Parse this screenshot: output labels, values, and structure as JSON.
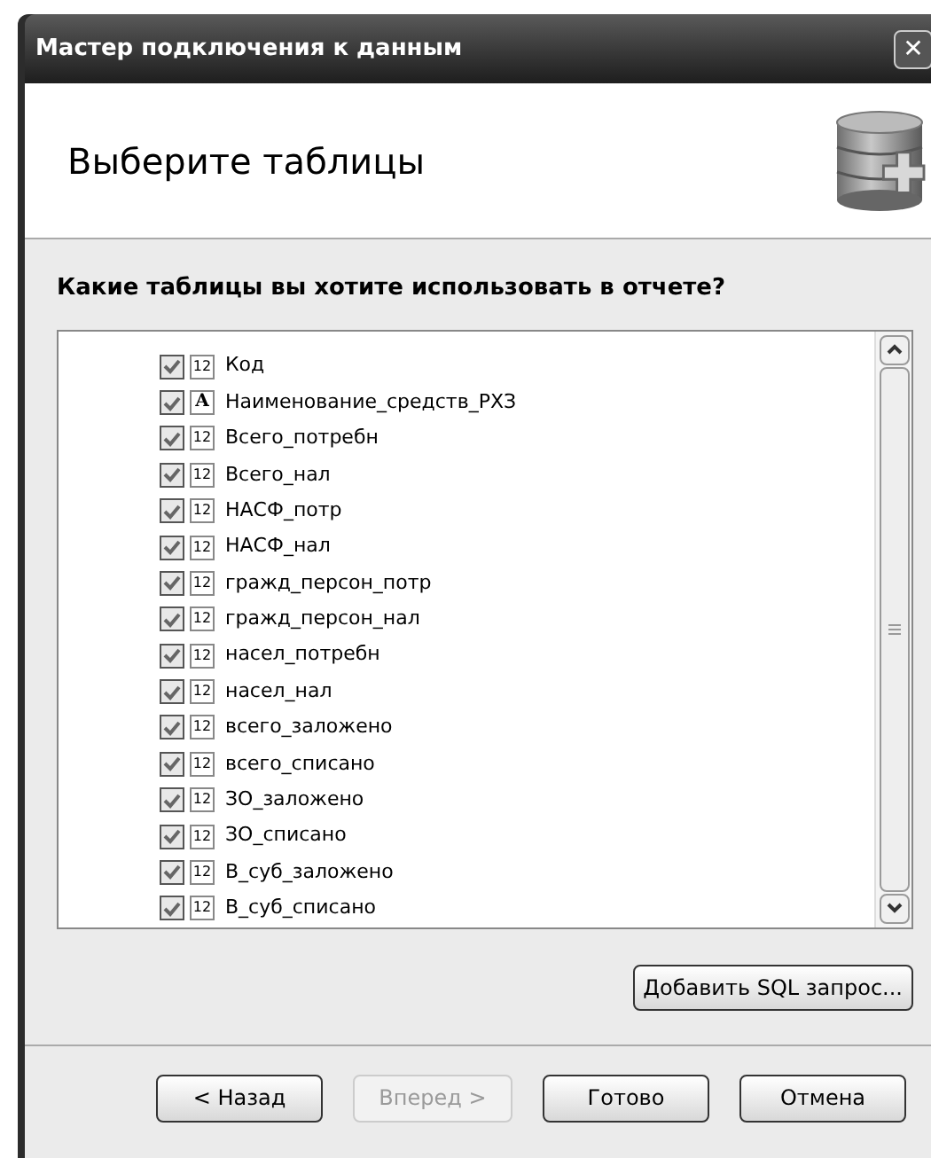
{
  "window": {
    "title": "Мастер подключения к данным",
    "close": "✕"
  },
  "header": {
    "title": "Выберите таблицы"
  },
  "question": "Какие таблицы вы хотите использовать в отчете?",
  "fields": [
    {
      "label": "Код",
      "checked": true,
      "type_glyph": "12",
      "kind": "number"
    },
    {
      "label": "Наименование_средств_РХЗ",
      "checked": true,
      "type_glyph": "A",
      "kind": "text"
    },
    {
      "label": "Всего_потребн",
      "checked": true,
      "type_glyph": "12",
      "kind": "number"
    },
    {
      "label": "Всего_нал",
      "checked": true,
      "type_glyph": "12",
      "kind": "number"
    },
    {
      "label": "НАСФ_потр",
      "checked": true,
      "type_glyph": "12",
      "kind": "number"
    },
    {
      "label": "НАСФ_нал",
      "checked": true,
      "type_glyph": "12",
      "kind": "number"
    },
    {
      "label": "гражд_персон_потр",
      "checked": true,
      "type_glyph": "12",
      "kind": "number"
    },
    {
      "label": "гражд_персон_нал",
      "checked": true,
      "type_glyph": "12",
      "kind": "number"
    },
    {
      "label": "насел_потребн",
      "checked": true,
      "type_glyph": "12",
      "kind": "number"
    },
    {
      "label": "насел_нал",
      "checked": true,
      "type_glyph": "12",
      "kind": "number"
    },
    {
      "label": "всего_заложено",
      "checked": true,
      "type_glyph": "12",
      "kind": "number"
    },
    {
      "label": "всего_списано",
      "checked": true,
      "type_glyph": "12",
      "kind": "number"
    },
    {
      "label": "ЗО_заложено",
      "checked": true,
      "type_glyph": "12",
      "kind": "number"
    },
    {
      "label": "ЗО_списано",
      "checked": true,
      "type_glyph": "12",
      "kind": "number"
    },
    {
      "label": "В_суб_заложено",
      "checked": true,
      "type_glyph": "12",
      "kind": "number"
    },
    {
      "label": "В_суб_списано",
      "checked": true,
      "type_glyph": "12",
      "kind": "number"
    }
  ],
  "add_sql_button": "Добавить SQL запрос...",
  "buttons": [
    {
      "label": "< Назад",
      "disabled": false
    },
    {
      "label": "Вперед >",
      "disabled": true
    },
    {
      "label": "Готово",
      "disabled": false
    },
    {
      "label": "Отмена",
      "disabled": false
    }
  ]
}
